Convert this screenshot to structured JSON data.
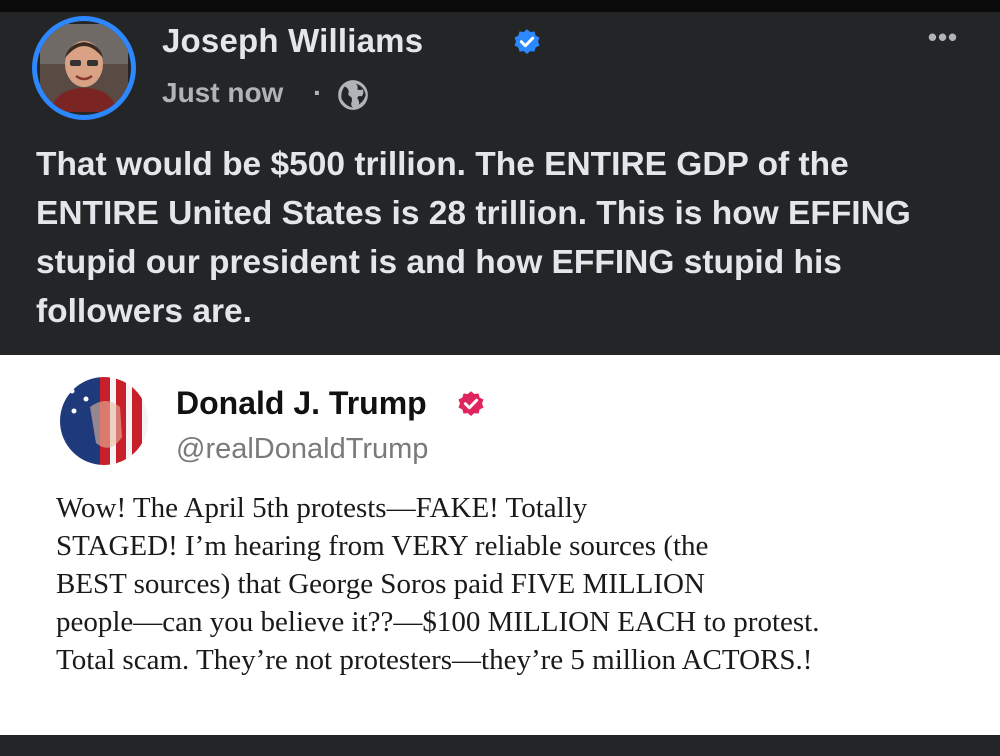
{
  "post": {
    "author": "Joseph Williams",
    "time": "Just now",
    "separator": "·",
    "more_label": "•••",
    "text": "That would be $500 trillion. The ENTIRE GDP of the ENTIRE United States is 28 trillion.  This is how EFFING stupid our president is and how EFFING stupid his followers are.",
    "icons": {
      "verified": "verified-badge-icon",
      "audience": "globe-icon",
      "more": "more-options-icon"
    },
    "colors": {
      "background": "#242526",
      "text": "#e4e6eb",
      "secondary": "#b0b3b8",
      "verified": "#2d88ff"
    }
  },
  "tweet": {
    "name": "Donald J. Trump",
    "handle": "@realDonaldTrump",
    "lines": [
      "Wow! The April 5th protests—FAKE! Totally",
      "STAGED! I’m hearing from VERY reliable sources (the",
      "BEST sources) that George Soros paid FIVE MILLION",
      "people—can you believe it??—$100 MILLION EACH to protest.",
      "Total scam. They’re not protesters—they’re 5 million ACTORS.!"
    ],
    "icons": {
      "verified": "verified-badge-icon"
    },
    "colors": {
      "background": "#ffffff",
      "verified": "#e0245e"
    }
  }
}
